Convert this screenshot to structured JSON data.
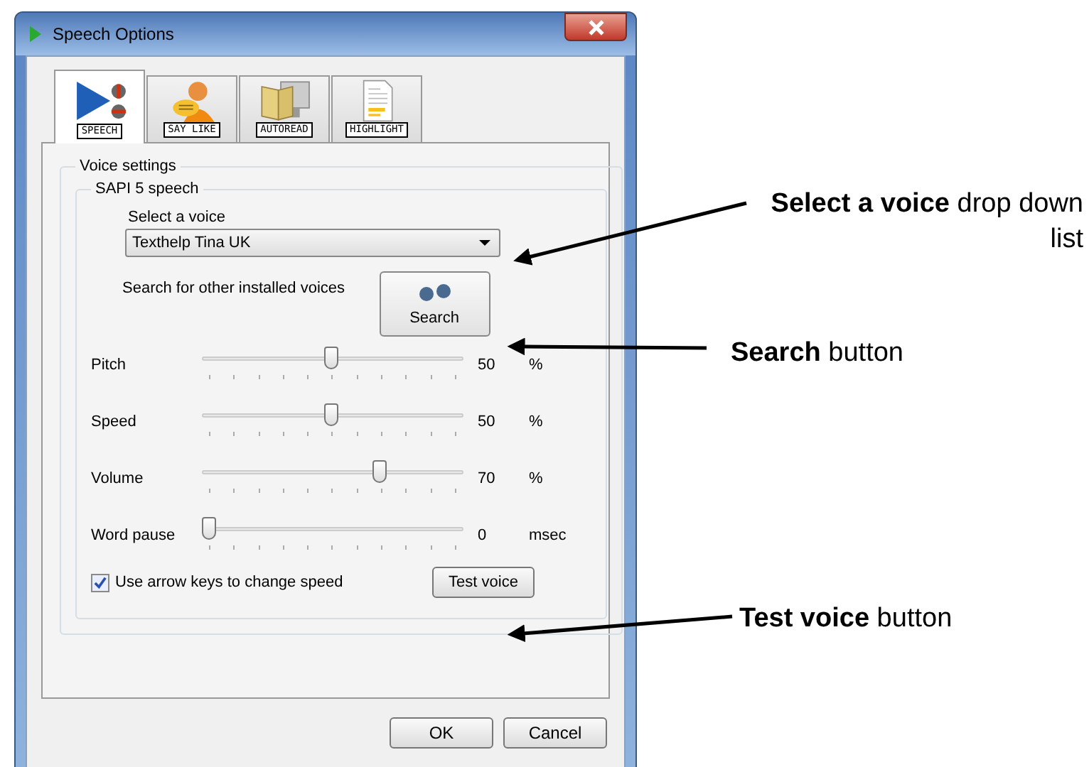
{
  "window": {
    "title": "Speech Options"
  },
  "tabs": [
    {
      "label": "SPEECH",
      "kind": "speech",
      "selected": true
    },
    {
      "label": "SAY LIKE",
      "kind": "saylike",
      "selected": false
    },
    {
      "label": "AUTOREAD",
      "kind": "autoread",
      "selected": false
    },
    {
      "label": "HIGHLIGHT",
      "kind": "highlight",
      "selected": false
    }
  ],
  "voice_settings": {
    "title": "Voice settings",
    "group_title": "SAPI 5 speech",
    "voice_label": "Select a voice",
    "voice_value": "Texthelp Tina UK",
    "search_label": "Search for other installed voices",
    "search_button": "Search",
    "sliders": [
      {
        "label": "Pitch",
        "level": 0.5,
        "reading": "50",
        "unit": "%"
      },
      {
        "label": "Speed",
        "level": 0.5,
        "reading": "50",
        "unit": "%"
      },
      {
        "label": "Volume",
        "level": 0.7,
        "reading": "70",
        "unit": "%"
      },
      {
        "label": "Word pause",
        "level": 0,
        "reading": "0",
        "unit": "msec"
      }
    ],
    "arrow_keys": {
      "label": "Use arrow keys to change speed",
      "checked": true
    },
    "test_button": "Test voice"
  },
  "buttons": [
    "OK",
    "Cancel"
  ],
  "annotations": [
    {
      "text": "**Select a voice** drop down list"
    },
    {
      "text": "**Search** button"
    },
    {
      "text": "**Test voice** button"
    }
  ]
}
